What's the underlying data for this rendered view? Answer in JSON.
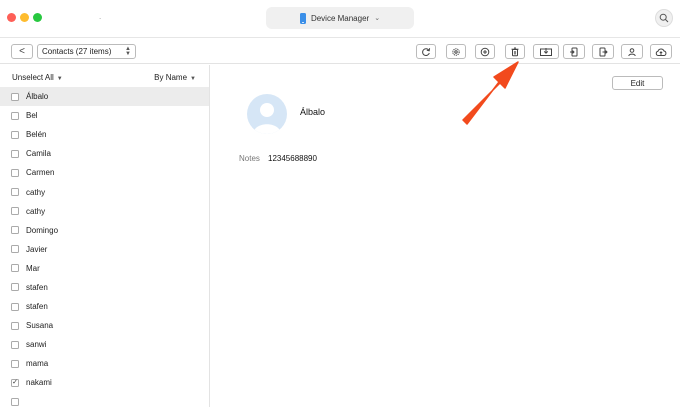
{
  "window": {
    "title_dot": ".",
    "device_selector": "Device Manager",
    "device_chevron": "⌄"
  },
  "toolbar": {
    "back_glyph": "<",
    "category_select": "Contacts (27 items)",
    "tools": [
      {
        "name": "refresh-icon"
      },
      {
        "name": "settings-icon"
      },
      {
        "name": "add-icon"
      },
      {
        "name": "delete-icon"
      },
      {
        "name": "export-to-computer-icon"
      },
      {
        "name": "import-icon"
      },
      {
        "name": "export-icon"
      },
      {
        "name": "contact-card-icon"
      },
      {
        "name": "cloud-upload-icon"
      }
    ]
  },
  "sidebar": {
    "unselect_all": "Unselect All",
    "sort_by": "By Name",
    "contacts": [
      {
        "name": "Álbalo",
        "checked": false,
        "selected": true
      },
      {
        "name": "Bel",
        "checked": false
      },
      {
        "name": "Belén",
        "checked": false
      },
      {
        "name": "Camila",
        "checked": false
      },
      {
        "name": "Carmen",
        "checked": false
      },
      {
        "name": "cathy",
        "checked": false
      },
      {
        "name": "cathy",
        "checked": false
      },
      {
        "name": "Domingo",
        "checked": false
      },
      {
        "name": "Javier",
        "checked": false
      },
      {
        "name": "Mar",
        "checked": false
      },
      {
        "name": "stafen",
        "checked": false
      },
      {
        "name": "stafen",
        "checked": false
      },
      {
        "name": "Susana",
        "checked": false
      },
      {
        "name": "sanwi",
        "checked": false
      },
      {
        "name": "mama",
        "checked": false
      },
      {
        "name": "nakami",
        "checked": true
      },
      {
        "name": "",
        "checked": false
      }
    ]
  },
  "detail": {
    "edit_label": "Edit",
    "contact_name": "Álbalo",
    "notes_label": "Notes",
    "notes_value": "12345688890"
  },
  "colors": {
    "arrow": "#f24a1d",
    "avatar_bg": "#d6e6f6",
    "avatar_fg": "#ffffff",
    "accent_phone": "#3b8fe8"
  }
}
